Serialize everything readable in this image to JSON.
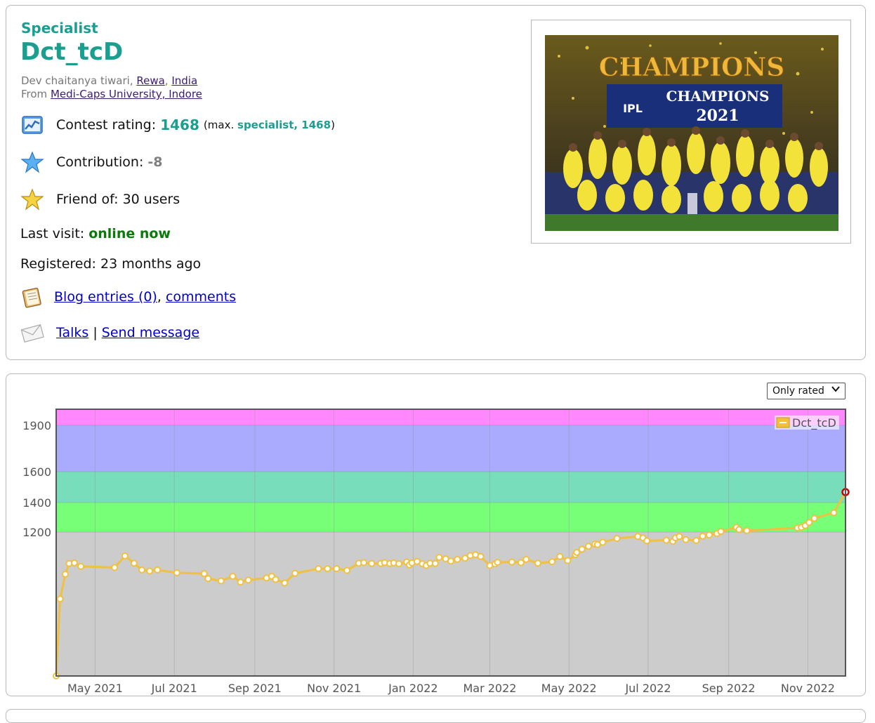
{
  "profile": {
    "rank": "Specialist",
    "handle": "Dct_tcD",
    "name": "Dev chaitanya tiwari",
    "city": "Rewa",
    "country": "India",
    "from_label": "From",
    "organization": "Medi-Caps University, Indore",
    "contest_rating_label": "Contest rating:",
    "contest_rating": "1468",
    "max_prefix": "(max.",
    "max_value": "specialist, 1468",
    "max_suffix": ")",
    "contribution_label": "Contribution:",
    "contribution": "-8",
    "friend_label": "Friend of:",
    "friend_value": "30 users",
    "last_visit_label": "Last visit:",
    "last_visit": "online now",
    "registered_label": "Registered:",
    "registered": "23 months ago",
    "blog_entries": "Blog entries (0)",
    "comments": "comments",
    "talks": "Talks",
    "separator": "|",
    "send_message": "Send message",
    "photo_text_top": "CHAMPIONS",
    "photo_text_banner": "CHAMPIONS",
    "photo_text_year": "2021",
    "photo_text_ipl": "IPL"
  },
  "filter": {
    "selected": "Only rated"
  },
  "icons": {
    "rating": "rating-chart-icon",
    "contribution": "blue-star-icon",
    "friends": "gold-star-icon",
    "blog": "notebook-icon",
    "talks": "envelope-icon"
  },
  "colors": {
    "rank": "#1a9e8f",
    "online": "#0a7a0a",
    "series": "#f0c040"
  },
  "chart_data": {
    "type": "line",
    "yticks": [
      1200,
      1400,
      1600,
      1900
    ],
    "ylim": [
      705,
      2000
    ],
    "xticks": [
      "May 2021",
      "Jul 2021",
      "Sep 2021",
      "Nov 2021",
      "Jan 2022",
      "Mar 2022",
      "May 2022",
      "Jul 2022",
      "Sep 2022",
      "Nov 2022"
    ],
    "bands": [
      {
        "from": 0,
        "to": 1200,
        "color": "#cccccc"
      },
      {
        "from": 1200,
        "to": 1400,
        "color": "#77ff77"
      },
      {
        "from": 1400,
        "to": 1600,
        "color": "#77ddbb"
      },
      {
        "from": 1600,
        "to": 1900,
        "color": "#aaaaff"
      },
      {
        "from": 1900,
        "to": 2000,
        "color": "#ff88ff"
      }
    ],
    "legend": "Dct_tcD",
    "series": [
      {
        "name": "Dct_tcD",
        "color": "#f0c040",
        "x": [
          "2021-04-01",
          "2021-04-04",
          "2021-04-08",
          "2021-04-11",
          "2021-04-15",
          "2021-04-20",
          "2021-05-16",
          "2021-05-24",
          "2021-05-31",
          "2021-06-06",
          "2021-06-12",
          "2021-06-18",
          "2021-07-03",
          "2021-07-24",
          "2021-07-27",
          "2021-08-06",
          "2021-08-15",
          "2021-08-21",
          "2021-08-27",
          "2021-09-10",
          "2021-09-14",
          "2021-09-17",
          "2021-09-24",
          "2021-10-02",
          "2021-10-20",
          "2021-10-27",
          "2021-11-03",
          "2021-11-11",
          "2021-11-20",
          "2021-11-24",
          "2021-11-30",
          "2021-12-07",
          "2021-12-10",
          "2021-12-14",
          "2021-12-17",
          "2021-12-21",
          "2021-12-27",
          "2021-12-29",
          "2021-12-31",
          "2022-01-04",
          "2022-01-08",
          "2022-01-11",
          "2022-01-14",
          "2022-01-18",
          "2022-01-21",
          "2022-01-26",
          "2022-01-30",
          "2022-02-04",
          "2022-02-10",
          "2022-02-14",
          "2022-02-18",
          "2022-02-22",
          "2022-03-01",
          "2022-03-05",
          "2022-03-07",
          "2022-03-18",
          "2022-03-25",
          "2022-03-29",
          "2022-04-07",
          "2022-04-18",
          "2022-04-24",
          "2022-04-30",
          "2022-05-06",
          "2022-05-07",
          "2022-05-11",
          "2022-05-16",
          "2022-05-21",
          "2022-05-23",
          "2022-05-27",
          "2022-06-07",
          "2022-06-23",
          "2022-06-27",
          "2022-06-30",
          "2022-07-15",
          "2022-07-20",
          "2022-07-22",
          "2022-07-25",
          "2022-07-30",
          "2022-08-07",
          "2022-08-12",
          "2022-08-17",
          "2022-08-23",
          "2022-08-26",
          "2022-09-07",
          "2022-09-09",
          "2022-09-15",
          "2022-10-24",
          "2022-10-27",
          "2022-10-30",
          "2022-11-02",
          "2022-11-06",
          "2022-11-21"
        ],
        "y": [
          705,
          970,
          1055,
          1092,
          1094,
          1082,
          1078,
          1118,
          1093,
          1070,
          1066,
          1070,
          1060,
          1057,
          1040,
          1032,
          1048,
          1028,
          1035,
          1042,
          1048,
          1037,
          1025,
          1058,
          1074,
          1074,
          1074,
          1068,
          1093,
          1095,
          1092,
          1092,
          1095,
          1092,
          1094,
          1091,
          1097,
          1087,
          1094,
          1099,
          1091,
          1085,
          1093,
          1092,
          1113,
          1108,
          1100,
          1106,
          1110,
          1119,
          1122,
          1116,
          1085,
          1090,
          1096,
          1097,
          1095,
          1106,
          1093,
          1098,
          1116,
          1102,
          1122,
          1130,
          1141,
          1151,
          1159,
          1157,
          1165,
          1178,
          1185,
          1180,
          1170,
          1172,
          1168,
          1180,
          1185,
          1174,
          1171,
          1186,
          1190,
          1195,
          1204,
          1232,
          1217,
          1210,
          1228,
          1232,
          1244,
          1265,
          1293,
          1331
        ]
      }
    ],
    "last_point": {
      "x": "2022-11-30",
      "y": 1468
    }
  }
}
